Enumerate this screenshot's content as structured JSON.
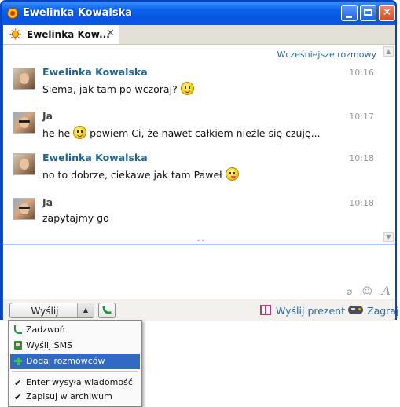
{
  "window": {
    "title": "Ewelinka Kowalska"
  },
  "tab": {
    "label": "Ewelinka Kow...",
    "close": "✕"
  },
  "chat": {
    "earlier_link": "Wcześniejsze rozmowy",
    "messages": [
      {
        "author": "Ewelinka Kowalska",
        "time": "10:16",
        "text": "Siema, jak tam po wczoraj?",
        "text2": ""
      },
      {
        "author": "Ja",
        "time": "10:17",
        "text": "he he",
        "text2": "powiem Ci, że nawet całkiem nieźle się czuję..."
      },
      {
        "author": "Ewelinka Kowalska",
        "time": "10:18",
        "text": "no to dobrze, ciekawe jak tam Paweł",
        "text2": ""
      },
      {
        "author": "Ja",
        "time": "10:18",
        "text": "zapytajmy go",
        "text2": ""
      }
    ]
  },
  "input": {
    "tools": [
      "paperclip-icon",
      "smiley-icon",
      "font-icon"
    ]
  },
  "bottombar": {
    "send_label": "Wyślij",
    "gift_label": "Wyślij prezent",
    "game_label": "Zagraj"
  },
  "menu": {
    "items": [
      {
        "label": "Zadzwoń",
        "icon": "phone-icon"
      },
      {
        "label": "Wyślij SMS",
        "icon": "sms-icon"
      },
      {
        "label": "Dodaj rozmówców",
        "icon": "add-icon",
        "highlighted": true
      },
      {
        "label": "Enter wysyła wiadomość",
        "checked": true
      },
      {
        "label": "Zapisuj w archiwum",
        "checked": true
      }
    ]
  },
  "colors": {
    "title_bar": "#0a58e6",
    "link": "#2a6aa8",
    "author_other": "#1f6592",
    "menu_highlight": "#316ac5"
  }
}
